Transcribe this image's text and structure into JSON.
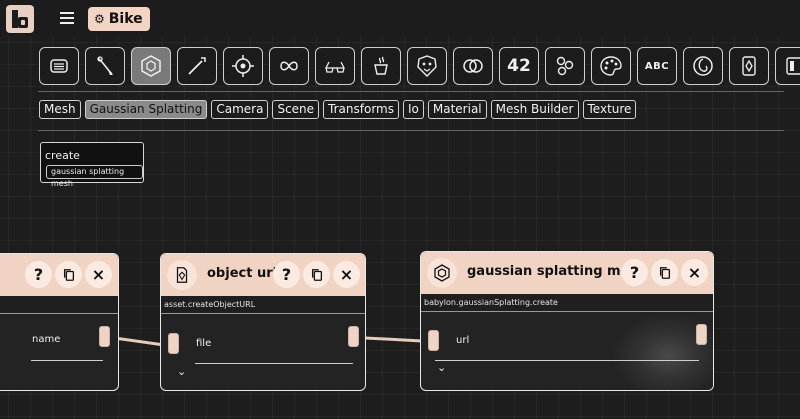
{
  "project": {
    "label": "Bike"
  },
  "toolbar": {
    "icons": [
      "list-icon",
      "brush-icon",
      "hexagon-cube-icon",
      "wand-icon",
      "target-icon",
      "infinity-icon",
      "glasses-icon",
      "coffee-icon",
      "lion-icon",
      "rings-icon",
      "number-42-icon",
      "molecule-icon",
      "palette-icon",
      "abc-icon",
      "swirl-icon",
      "tag-icon",
      "layout-icon"
    ],
    "number_label": "42",
    "text_label": "ABC",
    "active_index": 2
  },
  "tabs": [
    "Mesh",
    "Gaussian Splatting",
    "Camera",
    "Scene",
    "Transforms",
    "Io",
    "Material",
    "Mesh Builder",
    "Texture"
  ],
  "active_tab": "Gaussian Splatting",
  "create_panel": {
    "title": "create",
    "item": "gaussian splatting mesh"
  },
  "nodes": {
    "left": {
      "field": "name",
      "help": "?",
      "copy": "copy",
      "close": "×"
    },
    "object_url": {
      "title": "object url",
      "subtitle": "asset.createObjectURL",
      "field": "file",
      "help": "?",
      "close": "×"
    },
    "splat": {
      "title": "gaussian splatting mesh",
      "subtitle": "babylon.gaussianSplatting.create",
      "field": "url",
      "help": "?",
      "close": "×"
    }
  },
  "colors": {
    "accent": "#f1d3c3",
    "background": "#1c1c1c"
  }
}
